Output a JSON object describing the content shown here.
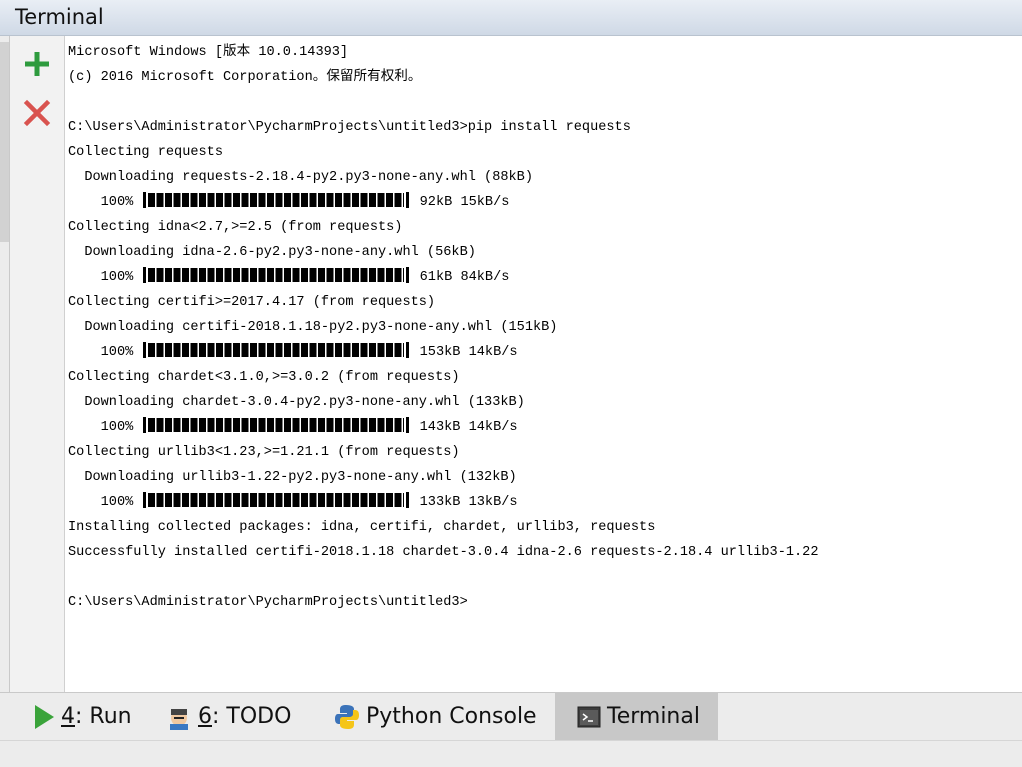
{
  "window": {
    "title": "Terminal"
  },
  "toolbar": {
    "add_icon": "plus-icon",
    "close_icon": "close-icon"
  },
  "colors": {
    "add_green": "#2e9b3e",
    "close_red": "#d9534f",
    "active_tab_bg": "#c8c8c8"
  },
  "terminal": {
    "lines": [
      {
        "type": "text",
        "text": "Microsoft Windows [版本 10.0.14393]"
      },
      {
        "type": "text",
        "text": "(c) 2016 Microsoft Corporation。保留所有权利。"
      },
      {
        "type": "text",
        "text": ""
      },
      {
        "type": "text",
        "text": "C:\\Users\\Administrator\\PycharmProjects\\untitled3>pip install requests"
      },
      {
        "type": "text",
        "text": "Collecting requests"
      },
      {
        "type": "text",
        "text": "  Downloading requests-2.18.4-py2.py3-none-any.whl (88kB)"
      },
      {
        "type": "progress",
        "percent": "100%",
        "progress_fraction": 1.0,
        "size": "92kB",
        "speed": "15kB/s"
      },
      {
        "type": "text",
        "text": "Collecting idna<2.7,>=2.5 (from requests)"
      },
      {
        "type": "text",
        "text": "  Downloading idna-2.6-py2.py3-none-any.whl (56kB)"
      },
      {
        "type": "progress",
        "percent": "100%",
        "progress_fraction": 1.0,
        "size": "61kB",
        "speed": "84kB/s"
      },
      {
        "type": "text",
        "text": "Collecting certifi>=2017.4.17 (from requests)"
      },
      {
        "type": "text",
        "text": "  Downloading certifi-2018.1.18-py2.py3-none-any.whl (151kB)"
      },
      {
        "type": "progress",
        "percent": "100%",
        "progress_fraction": 1.0,
        "size": "153kB",
        "speed": "14kB/s"
      },
      {
        "type": "text",
        "text": "Collecting chardet<3.1.0,>=3.0.2 (from requests)"
      },
      {
        "type": "text",
        "text": "  Downloading chardet-3.0.4-py2.py3-none-any.whl (133kB)"
      },
      {
        "type": "progress",
        "percent": "100%",
        "progress_fraction": 1.0,
        "size": "143kB",
        "speed": "14kB/s"
      },
      {
        "type": "text",
        "text": "Collecting urllib3<1.23,>=1.21.1 (from requests)"
      },
      {
        "type": "text",
        "text": "  Downloading urllib3-1.22-py2.py3-none-any.whl (132kB)"
      },
      {
        "type": "progress",
        "percent": "100%",
        "progress_fraction": 1.0,
        "size": "133kB",
        "speed": "13kB/s"
      },
      {
        "type": "text",
        "text": "Installing collected packages: idna, certifi, chardet, urllib3, requests"
      },
      {
        "type": "text",
        "text": "Successfully installed certifi-2018.1.18 chardet-3.0.4 idna-2.6 requests-2.18.4 urllib3-1.22"
      },
      {
        "type": "text",
        "text": ""
      },
      {
        "type": "text",
        "text": "C:\\Users\\Administrator\\PycharmProjects\\untitled3>"
      }
    ]
  },
  "bottom_tabs": [
    {
      "mnemonic": "4",
      "label": ": Run",
      "icon": "run-icon",
      "active": false
    },
    {
      "mnemonic": "6",
      "label": ": TODO",
      "icon": "todo-icon",
      "active": false
    },
    {
      "mnemonic": "",
      "label": "Python Console",
      "icon": "python-icon",
      "active": false
    },
    {
      "mnemonic": "",
      "label": "Terminal",
      "icon": "terminal-icon",
      "active": true
    }
  ]
}
